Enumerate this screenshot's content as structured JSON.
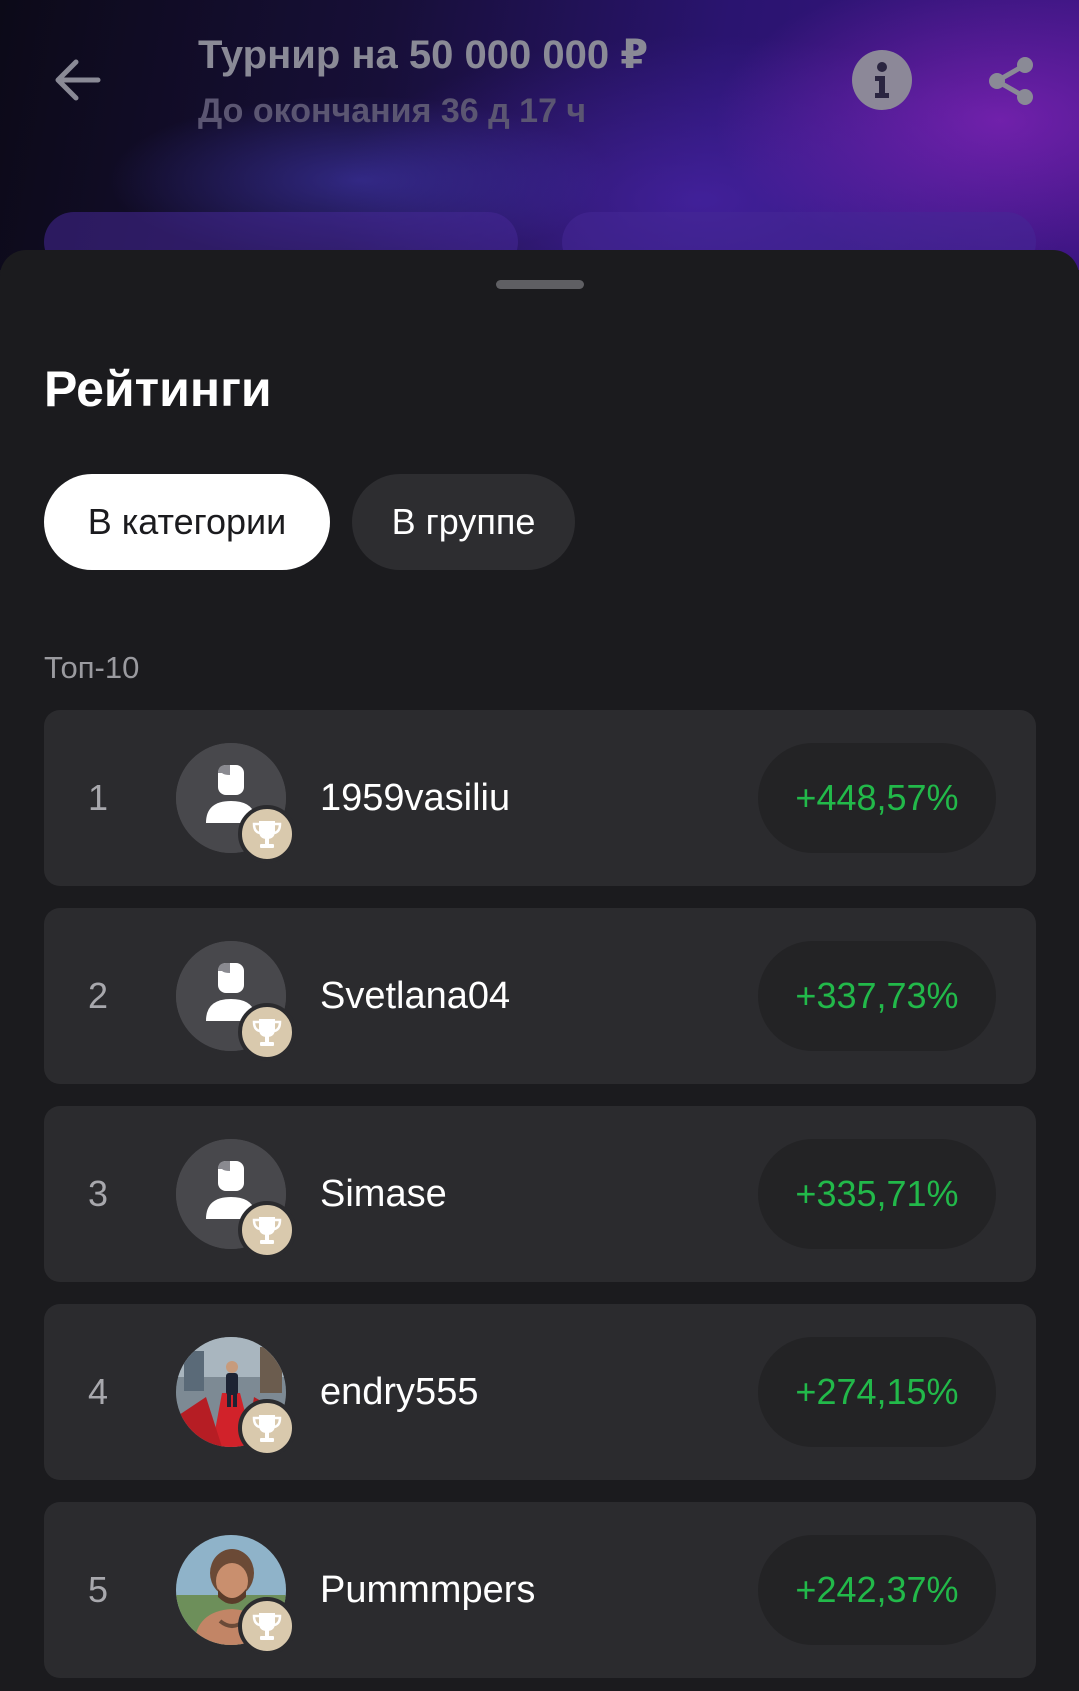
{
  "header": {
    "title": "Турнир на 50 000 000 ₽",
    "subtitle": "До окончания 36 д 17 ч",
    "back_icon": "arrow-left-icon",
    "info_icon": "info-icon",
    "share_icon": "share-icon"
  },
  "sheet": {
    "title": "Рейтинги",
    "tabs": [
      {
        "label": "В категории",
        "active": true
      },
      {
        "label": "В группе",
        "active": false
      }
    ],
    "section_label": "Топ-10"
  },
  "leaderboard": [
    {
      "rank": "1",
      "username": "1959vasiliu",
      "change": "+448,57%",
      "avatar": "default-avatar"
    },
    {
      "rank": "2",
      "username": "Svetlana04",
      "change": "+337,73%",
      "avatar": "default-avatar"
    },
    {
      "rank": "3",
      "username": "Simase",
      "change": "+335,71%",
      "avatar": "default-avatar"
    },
    {
      "rank": "4",
      "username": "endry555",
      "change": "+274,15%",
      "avatar": "photo-red-carpet"
    },
    {
      "rank": "5",
      "username": "Pummmpers",
      "change": "+242,37%",
      "avatar": "photo-man-outdoor"
    }
  ],
  "colors": {
    "positive": "#22b94a",
    "sheet_bg": "#1b1b1e",
    "row_bg": "#2b2b2e",
    "trophy_badge": "#d9c9ad"
  }
}
